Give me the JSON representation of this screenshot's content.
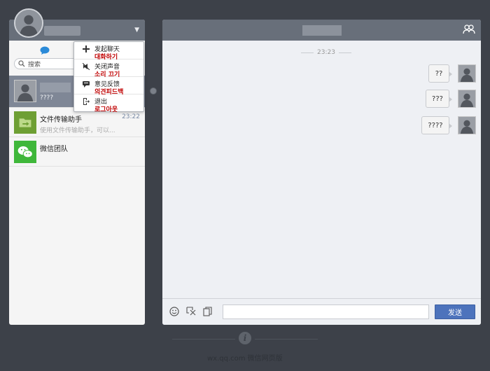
{
  "search": {
    "placeholder": "搜索"
  },
  "conversations": [
    {
      "name": "",
      "preview": "????",
      "time": ""
    },
    {
      "name": "文件传输助手",
      "preview": "使用文件传输助手，可以...",
      "time": "23:22"
    },
    {
      "name": "微信团队",
      "preview": "",
      "time": ""
    }
  ],
  "menu": {
    "items": [
      {
        "label": "发起聊天",
        "korean": "대화하기",
        "icon": "plus-icon"
      },
      {
        "label": "关闭声音",
        "korean": "소리 끄기",
        "icon": "mute-icon"
      },
      {
        "label": "意见反馈",
        "korean": "의견피드백",
        "icon": "feedback-icon"
      },
      {
        "label": "退出",
        "korean": "로그아웃",
        "icon": "logout-icon"
      }
    ]
  },
  "chat": {
    "time_divider": "23:23",
    "messages": [
      {
        "text": "??",
        "sender": "me"
      },
      {
        "text": "???",
        "sender": "me"
      },
      {
        "text": "????",
        "sender": "me"
      }
    ],
    "input_value": "",
    "send_label": "发送"
  },
  "footer": {
    "brand": "wx.qq.com  微信网页版"
  },
  "colors": {
    "background": "#3d4149",
    "header": "#686f7a",
    "send_button": "#4d73bc",
    "active_row": "#7f8796",
    "menu_korean_text": "#c00000"
  }
}
